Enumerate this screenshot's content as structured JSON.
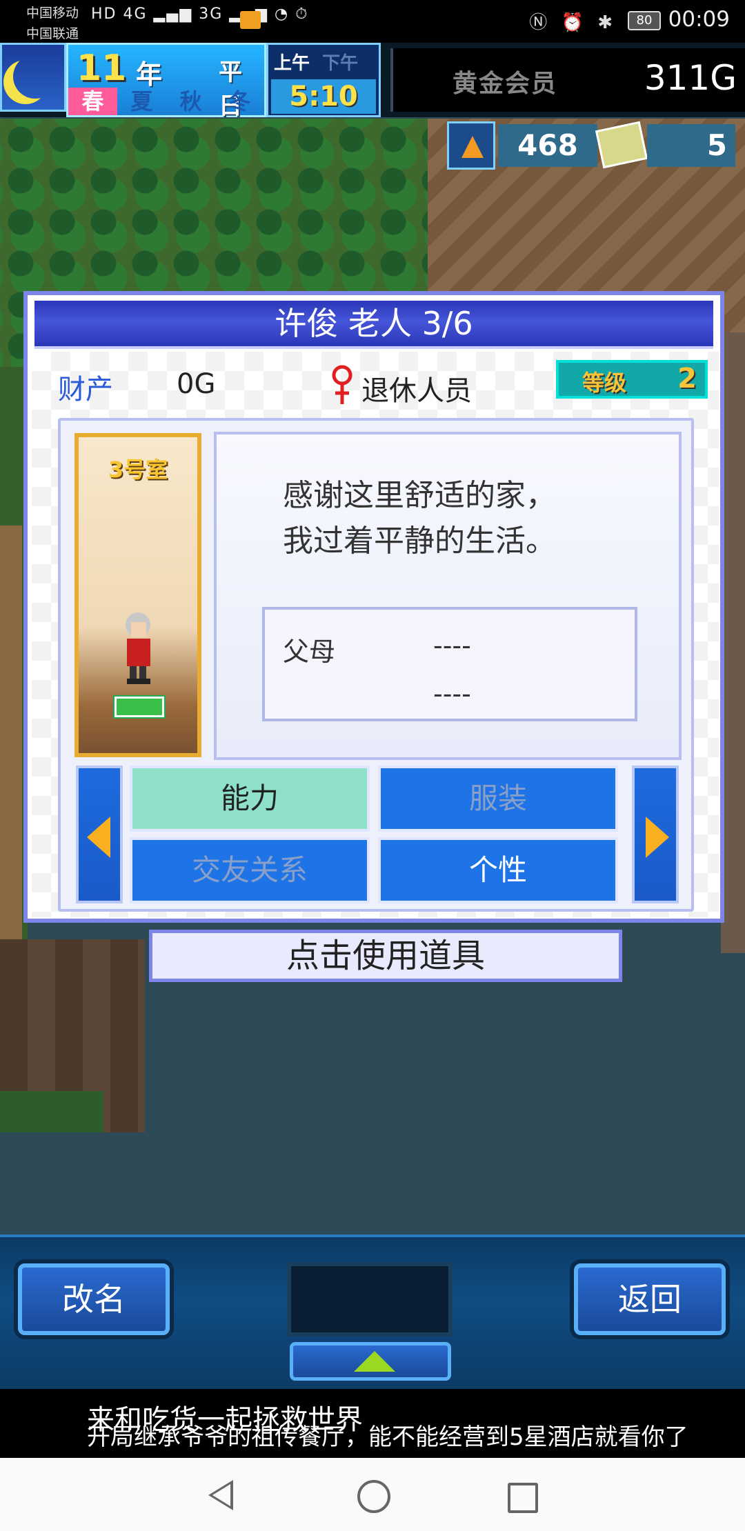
{
  "status_bar": {
    "carrier1": "中国移动",
    "carrier2": "中国联通",
    "signal": "HD 4G 3G",
    "battery": "80",
    "time": "00:09"
  },
  "hud": {
    "year": "11",
    "year_label": "年",
    "weekday": "平日",
    "seasons": [
      "春",
      "夏",
      "秋",
      "冬"
    ],
    "active_season": "春",
    "am_label": "上午",
    "pm_label": "下午",
    "time": "5:10",
    "member": "黄金会员",
    "gold": "311G",
    "research_points": "468",
    "tickets": "5"
  },
  "dialog": {
    "title": "许俊 老人 3/6",
    "property_label": "财产",
    "property_value": "0G",
    "job": "退休人员",
    "level_label": "等级",
    "level_value": "2",
    "room": "3号室",
    "message_line1": "感谢这里舒适的家，",
    "message_line2": "我过着平静的生活。",
    "family_label": "父母",
    "family_value1": "----",
    "family_value2": "----",
    "tabs": {
      "ability": "能力",
      "clothes": "服装",
      "friends": "交友关系",
      "personality": "个性"
    },
    "use_item": "点击使用道具"
  },
  "bottom_bar": {
    "rename": "改名",
    "back": "返回"
  },
  "ad": {
    "line1": "来和吃货一起拯救世界",
    "line2": "开局继承爷爷的祖传餐厅，能不能经营到5星酒店就看你了"
  },
  "colors": {
    "dialog_border": "#7d86e8",
    "title_bar": "#2a36b8",
    "tab_active": "#8fe0c8",
    "tab_inactive": "#1e74e6",
    "accent_gold": "#f8c53a"
  }
}
